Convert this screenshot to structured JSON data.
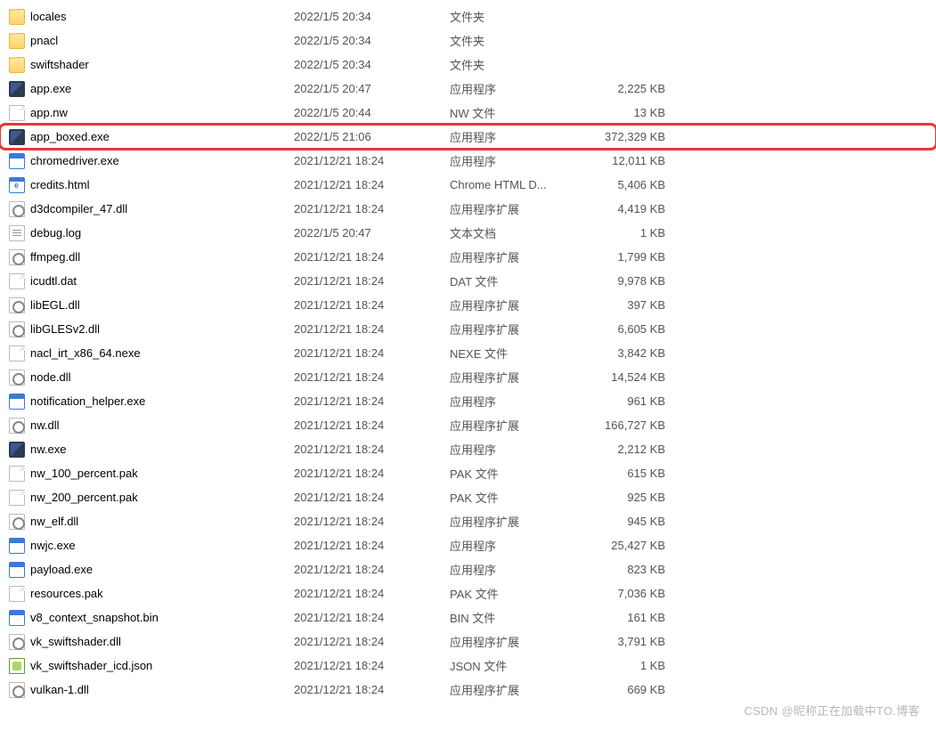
{
  "watermark": "CSDN @昵称正在加载中TO.博客",
  "files": [
    {
      "name": "locales",
      "date": "2022/1/5 20:34",
      "type": "文件夹",
      "size": "",
      "icon": "folder",
      "hl": false
    },
    {
      "name": "pnacl",
      "date": "2022/1/5 20:34",
      "type": "文件夹",
      "size": "",
      "icon": "folder",
      "hl": false
    },
    {
      "name": "swiftshader",
      "date": "2022/1/5 20:34",
      "type": "文件夹",
      "size": "",
      "icon": "folder",
      "hl": false
    },
    {
      "name": "app.exe",
      "date": "2022/1/5 20:47",
      "type": "应用程序",
      "size": "2,225 KB",
      "icon": "exe-dark",
      "hl": false
    },
    {
      "name": "app.nw",
      "date": "2022/1/5 20:44",
      "type": "NW 文件",
      "size": "13 KB",
      "icon": "file",
      "hl": false
    },
    {
      "name": "app_boxed.exe",
      "date": "2022/1/5 21:06",
      "type": "应用程序",
      "size": "372,329 KB",
      "icon": "exe-dark",
      "hl": true
    },
    {
      "name": "chromedriver.exe",
      "date": "2021/12/21 18:24",
      "type": "应用程序",
      "size": "12,011 KB",
      "icon": "exe-win",
      "hl": false
    },
    {
      "name": "credits.html",
      "date": "2021/12/21 18:24",
      "type": "Chrome HTML D...",
      "size": "5,406 KB",
      "icon": "html",
      "hl": false
    },
    {
      "name": "d3dcompiler_47.dll",
      "date": "2021/12/21 18:24",
      "type": "应用程序扩展",
      "size": "4,419 KB",
      "icon": "dll",
      "hl": false
    },
    {
      "name": "debug.log",
      "date": "2022/1/5 20:47",
      "type": "文本文档",
      "size": "1 KB",
      "icon": "txt",
      "hl": false
    },
    {
      "name": "ffmpeg.dll",
      "date": "2021/12/21 18:24",
      "type": "应用程序扩展",
      "size": "1,799 KB",
      "icon": "dll",
      "hl": false
    },
    {
      "name": "icudtl.dat",
      "date": "2021/12/21 18:24",
      "type": "DAT 文件",
      "size": "9,978 KB",
      "icon": "file",
      "hl": false
    },
    {
      "name": "libEGL.dll",
      "date": "2021/12/21 18:24",
      "type": "应用程序扩展",
      "size": "397 KB",
      "icon": "dll",
      "hl": false
    },
    {
      "name": "libGLESv2.dll",
      "date": "2021/12/21 18:24",
      "type": "应用程序扩展",
      "size": "6,605 KB",
      "icon": "dll",
      "hl": false
    },
    {
      "name": "nacl_irt_x86_64.nexe",
      "date": "2021/12/21 18:24",
      "type": "NEXE 文件",
      "size": "3,842 KB",
      "icon": "file",
      "hl": false
    },
    {
      "name": "node.dll",
      "date": "2021/12/21 18:24",
      "type": "应用程序扩展",
      "size": "14,524 KB",
      "icon": "dll",
      "hl": false
    },
    {
      "name": "notification_helper.exe",
      "date": "2021/12/21 18:24",
      "type": "应用程序",
      "size": "961 KB",
      "icon": "exe-win",
      "hl": false
    },
    {
      "name": "nw.dll",
      "date": "2021/12/21 18:24",
      "type": "应用程序扩展",
      "size": "166,727 KB",
      "icon": "dll",
      "hl": false
    },
    {
      "name": "nw.exe",
      "date": "2021/12/21 18:24",
      "type": "应用程序",
      "size": "2,212 KB",
      "icon": "exe-dark",
      "hl": false
    },
    {
      "name": "nw_100_percent.pak",
      "date": "2021/12/21 18:24",
      "type": "PAK 文件",
      "size": "615 KB",
      "icon": "file",
      "hl": false
    },
    {
      "name": "nw_200_percent.pak",
      "date": "2021/12/21 18:24",
      "type": "PAK 文件",
      "size": "925 KB",
      "icon": "file",
      "hl": false
    },
    {
      "name": "nw_elf.dll",
      "date": "2021/12/21 18:24",
      "type": "应用程序扩展",
      "size": "945 KB",
      "icon": "dll",
      "hl": false
    },
    {
      "name": "nwjc.exe",
      "date": "2021/12/21 18:24",
      "type": "应用程序",
      "size": "25,427 KB",
      "icon": "exe-win",
      "hl": false
    },
    {
      "name": "payload.exe",
      "date": "2021/12/21 18:24",
      "type": "应用程序",
      "size": "823 KB",
      "icon": "exe-win",
      "hl": false
    },
    {
      "name": "resources.pak",
      "date": "2021/12/21 18:24",
      "type": "PAK 文件",
      "size": "7,036 KB",
      "icon": "file",
      "hl": false
    },
    {
      "name": "v8_context_snapshot.bin",
      "date": "2021/12/21 18:24",
      "type": "BIN 文件",
      "size": "161 KB",
      "icon": "exe-win",
      "hl": false
    },
    {
      "name": "vk_swiftshader.dll",
      "date": "2021/12/21 18:24",
      "type": "应用程序扩展",
      "size": "3,791 KB",
      "icon": "dll",
      "hl": false
    },
    {
      "name": "vk_swiftshader_icd.json",
      "date": "2021/12/21 18:24",
      "type": "JSON 文件",
      "size": "1 KB",
      "icon": "json",
      "hl": false
    },
    {
      "name": "vulkan-1.dll",
      "date": "2021/12/21 18:24",
      "type": "应用程序扩展",
      "size": "669 KB",
      "icon": "dll",
      "hl": false
    }
  ]
}
